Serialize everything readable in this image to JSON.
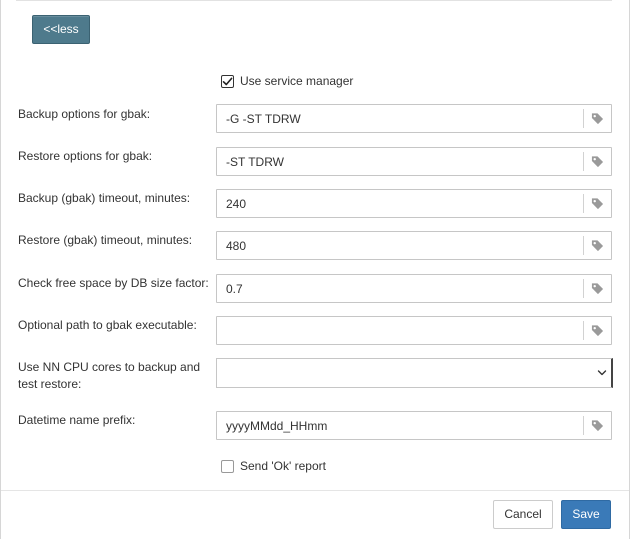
{
  "less_button": {
    "label": "<<less"
  },
  "use_service_manager": {
    "label": "Use service manager",
    "checked": true
  },
  "fields": [
    {
      "label": "Backup options for gbak:",
      "value": "-G -ST TDRW"
    },
    {
      "label": "Restore options for gbak:",
      "value": "-ST TDRW"
    },
    {
      "label": "Backup (gbak) timeout, minutes:",
      "value": "240"
    },
    {
      "label": "Restore (gbak) timeout, minutes:",
      "value": "480"
    },
    {
      "label": "Check free space by DB size factor:",
      "value": "0.7"
    },
    {
      "label": "Optional path to gbak executable:",
      "value": ""
    }
  ],
  "cpu_cores": {
    "label": "Use NN CPU cores to backup and test restore:",
    "selected": ""
  },
  "datetime_prefix": {
    "label": "Datetime name prefix:",
    "value": "yyyyMMdd_HHmm"
  },
  "send_ok_report": {
    "label": "Send 'Ok' report",
    "checked": false
  },
  "footer": {
    "cancel_label": "Cancel",
    "save_label": "Save"
  },
  "icons": {
    "field_action": "tag-icon",
    "dropdown": "chevron-down-icon"
  },
  "colors": {
    "less_button_bg": "#4e7a8c",
    "save_button_bg": "#3a7ab8"
  }
}
